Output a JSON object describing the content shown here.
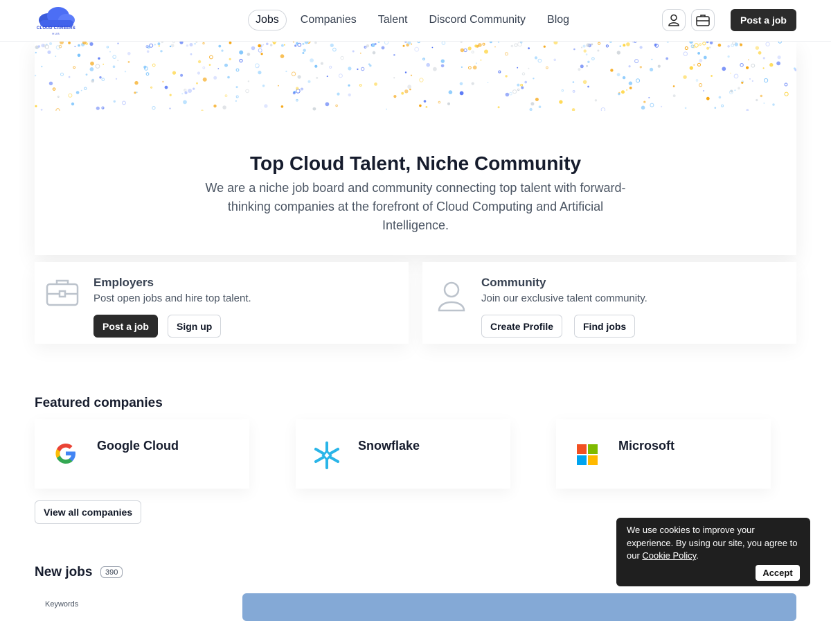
{
  "header": {
    "logo_text": "CLOUD CAREERS",
    "logo_sub": "HUB",
    "nav": [
      "Jobs",
      "Companies",
      "Talent",
      "Discord Community",
      "Blog"
    ],
    "post_job": "Post a job",
    "icons": [
      "user-icon",
      "briefcase-icon"
    ]
  },
  "hero": {
    "title": "Top Cloud Talent, Niche Community",
    "description": "We are a niche job board and community connecting top talent with forward-thinking companies at the forefront of Cloud Computing and Artificial Intelligence."
  },
  "employers": {
    "title": "Employers",
    "subtitle": "Post open jobs and hire top talent.",
    "primary": "Post a job",
    "secondary": "Sign up"
  },
  "community": {
    "title": "Community",
    "subtitle": "Join our exclusive talent community.",
    "primary": "Create Profile",
    "secondary": "Find jobs"
  },
  "featured": {
    "title": "Featured companies",
    "companies": [
      "Google Cloud",
      "Snowflake",
      "Microsoft"
    ],
    "view_all": "View all companies"
  },
  "jobs": {
    "title": "New jobs",
    "count": "390",
    "keywords_label": "Keywords"
  },
  "cookie": {
    "text": "We use cookies to improve your experience. By using our site, you agree to our ",
    "link": "Cookie Policy",
    "period": ".",
    "accept": "Accept"
  },
  "colors": {
    "accent": "#2b2b2b",
    "brand_blue": "#2f4ad6",
    "panel_blue": "#84a9d6"
  }
}
